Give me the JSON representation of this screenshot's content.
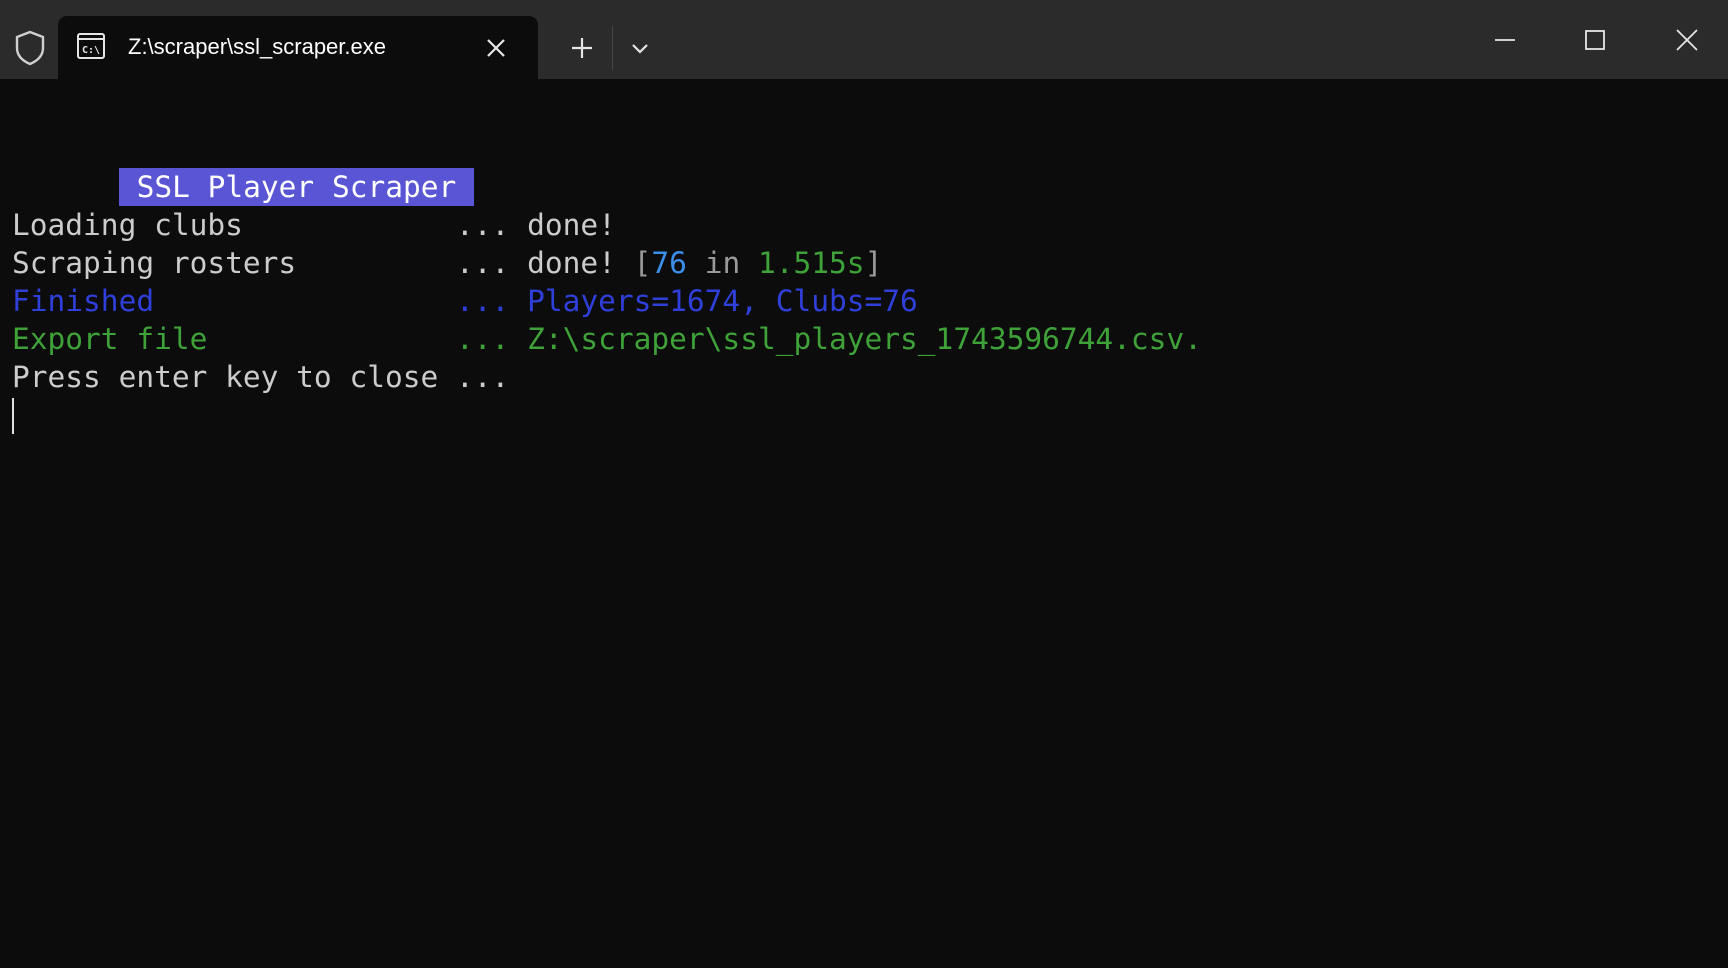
{
  "titlebar": {
    "tab_title": "Z:\\scraper\\ssl_scraper.exe",
    "icons": {
      "shield": "shield-icon",
      "app": "console-app-icon",
      "tab_close": "close-icon",
      "new_tab": "plus-icon",
      "dropdown": "chevron-down-icon",
      "minimize": "minimize-icon",
      "maximize": "maximize-icon",
      "close": "close-icon"
    }
  },
  "terminal": {
    "banner": "SSL Player Scraper",
    "lines": [
      {
        "label": "Loading clubs            ",
        "dots": "... ",
        "value": "done!"
      },
      {
        "label": "Scraping rosters         ",
        "dots": "... ",
        "value": "done! ",
        "detail_open": "[",
        "detail_count": "76",
        "detail_in": " in ",
        "detail_time": "1.515s",
        "detail_close": "]"
      },
      {
        "label": "Finished                 ",
        "dots": "... ",
        "value": "Players=1674, Clubs=76"
      },
      {
        "label": "Export file              ",
        "dots": "... ",
        "value": "Z:\\scraper\\ssl_players_1743596744.csv."
      },
      {
        "label": "Press enter key to close ...",
        "dots": "",
        "value": ""
      }
    ]
  },
  "colors": {
    "background": "#0c0c0c",
    "titlebar": "#2b2b2b",
    "banner_bg": "#5a55d4",
    "text_default": "#cccccc",
    "text_blue": "#2f3fd9",
    "text_green": "#3ea238",
    "text_cyan": "#3b8eea",
    "text_gray": "#9a9a9a"
  }
}
